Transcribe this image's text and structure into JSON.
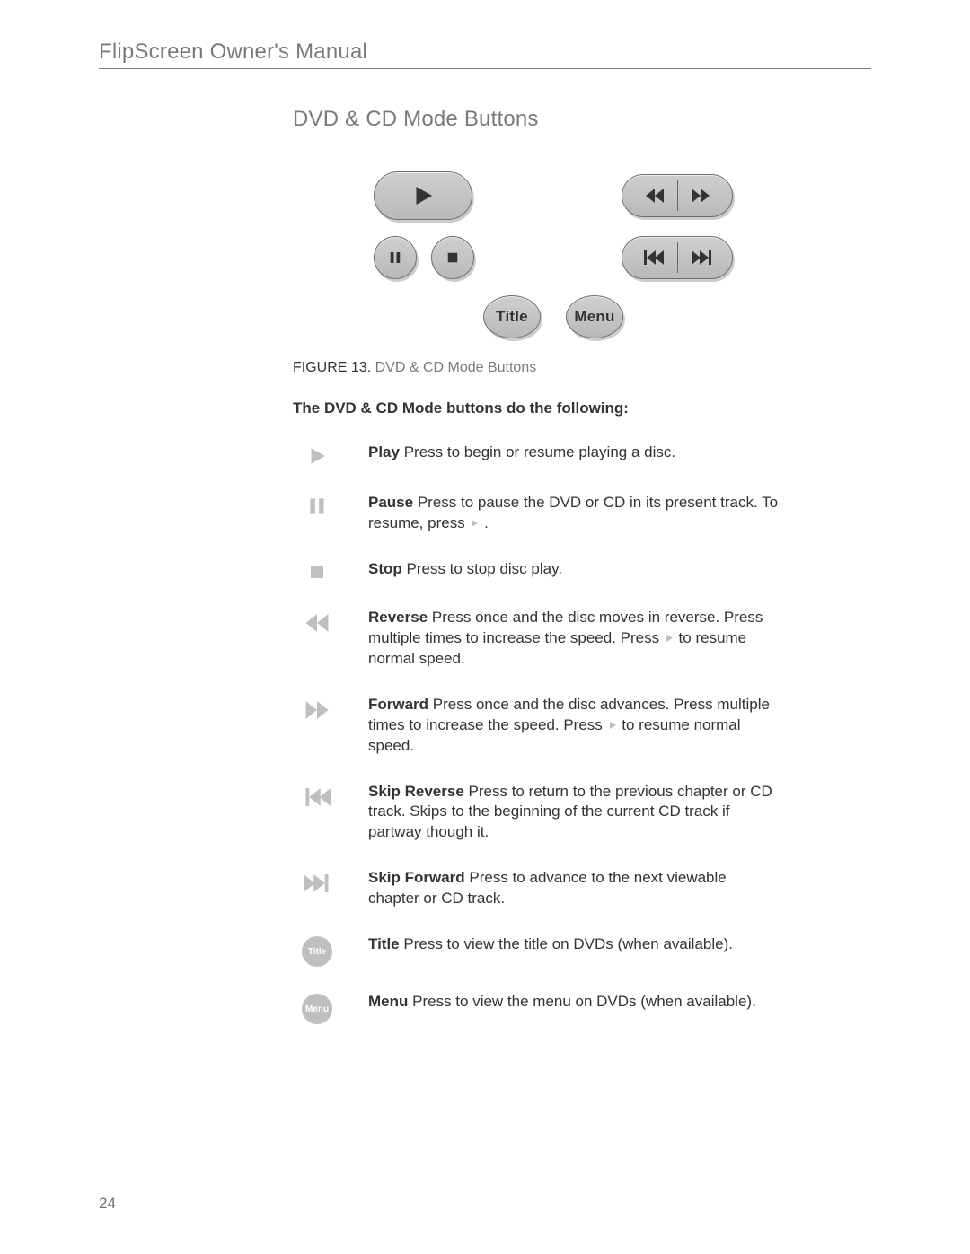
{
  "header": "FlipScreen Owner's Manual",
  "section_title": "DVD & CD Mode Buttons",
  "figure": {
    "caption_label": "FIGURE 13.",
    "caption_text": "DVD & CD Mode Buttons",
    "buttons": {
      "title": "Title",
      "menu": "Menu"
    }
  },
  "intro": "The DVD & CD Mode buttons do the following:",
  "definitions": [
    {
      "icon": "play",
      "term": "Play",
      "body": "Press to begin or resume playing a disc."
    },
    {
      "icon": "pause",
      "term": "Pause",
      "body": "Press to pause the DVD or CD in its present track. To resume, press",
      "trail": "play-then-period"
    },
    {
      "icon": "stop",
      "term": "Stop",
      "body": "Press to stop disc play."
    },
    {
      "icon": "reverse",
      "term": "Reverse",
      "body": "Press once and the disc moves in reverse. Press multiple times to increase the speed. Press",
      "trail": "play-then-text",
      "trail_text": "to resume normal speed."
    },
    {
      "icon": "forward",
      "term": "Forward",
      "body": "Press once and the disc advances. Press multiple times to increase the speed. Press",
      "trail": "play-then-text",
      "trail_text": "to resume normal speed."
    },
    {
      "icon": "skip-reverse",
      "term": "Skip Reverse",
      "body": "Press to return to the previous chapter or CD track. Skips to the beginning of the current CD track if partway though it."
    },
    {
      "icon": "skip-forward",
      "term": "Skip Forward",
      "body": "Press to advance to the next viewable chapter or CD track."
    },
    {
      "icon": "title",
      "term": "Title",
      "body": "Press to view the title on DVDs (when available)."
    },
    {
      "icon": "menu",
      "term": "Menu",
      "body": "Press to view the menu on DVDs (when available)."
    }
  ],
  "mini_labels": {
    "title": "Title",
    "menu": "Menu"
  },
  "page_number": "24"
}
